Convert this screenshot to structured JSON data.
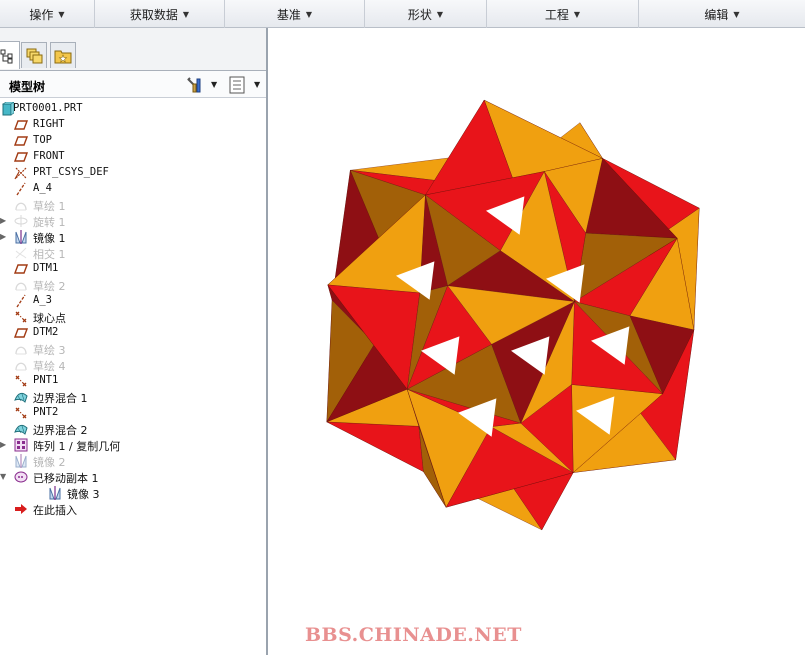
{
  "ribbon": {
    "groups": [
      {
        "label": "操作"
      },
      {
        "label": "获取数据"
      },
      {
        "label": "基准"
      },
      {
        "label": "形状"
      },
      {
        "label": "工程"
      },
      {
        "label": "编辑"
      }
    ]
  },
  "panel": {
    "tabs": [
      {
        "icon": "model-tree-tab-icon"
      },
      {
        "icon": "layers-tab-icon"
      },
      {
        "icon": "favorites-folder-tab-icon"
      }
    ],
    "tree_title": "模型树",
    "settings_icon": "tree-settings-icon",
    "show_icon": "tree-show-icon"
  },
  "tree": {
    "items": [
      {
        "label": "PRT0001.PRT",
        "icon": "part-icon",
        "dim": false,
        "expander": ""
      },
      {
        "label": "RIGHT",
        "icon": "datum-plane-icon",
        "dim": false,
        "expander": ""
      },
      {
        "label": "TOP",
        "icon": "datum-plane-icon",
        "dim": false,
        "expander": ""
      },
      {
        "label": "FRONT",
        "icon": "datum-plane-icon",
        "dim": false,
        "expander": ""
      },
      {
        "label": "PRT_CSYS_DEF",
        "icon": "coordinate-system-icon",
        "dim": false,
        "expander": ""
      },
      {
        "label": "A_4",
        "icon": "datum-axis-icon",
        "dim": false,
        "expander": ""
      },
      {
        "label": "草绘 1",
        "icon": "sketch-icon",
        "dim": true,
        "expander": ""
      },
      {
        "label": "旋转 1",
        "icon": "revolve-icon",
        "dim": true,
        "expander": "▶"
      },
      {
        "label": "镜像 1",
        "icon": "mirror-icon",
        "dim": false,
        "expander": "▶"
      },
      {
        "label": "相交 1",
        "icon": "intersect-icon",
        "dim": true,
        "expander": ""
      },
      {
        "label": "DTM1",
        "icon": "datum-plane-icon",
        "dim": false,
        "expander": ""
      },
      {
        "label": "草绘 2",
        "icon": "sketch-icon",
        "dim": true,
        "expander": ""
      },
      {
        "label": "A_3",
        "icon": "datum-axis-icon",
        "dim": false,
        "expander": ""
      },
      {
        "label": "球心点",
        "icon": "datum-point-icon",
        "dim": false,
        "expander": ""
      },
      {
        "label": "DTM2",
        "icon": "datum-plane-icon",
        "dim": false,
        "expander": ""
      },
      {
        "label": "草绘 3",
        "icon": "sketch-icon",
        "dim": true,
        "expander": ""
      },
      {
        "label": "草绘 4",
        "icon": "sketch-icon",
        "dim": true,
        "expander": ""
      },
      {
        "label": "PNT1",
        "icon": "datum-point-icon",
        "dim": false,
        "expander": ""
      },
      {
        "label": "边界混合 1",
        "icon": "boundary-blend-icon",
        "dim": false,
        "expander": ""
      },
      {
        "label": "PNT2",
        "icon": "datum-point-icon",
        "dim": false,
        "expander": ""
      },
      {
        "label": "边界混合 2",
        "icon": "boundary-blend-icon",
        "dim": false,
        "expander": ""
      },
      {
        "label": "阵列 1 / 复制几何",
        "icon": "pattern-icon",
        "dim": false,
        "expander": "▶"
      },
      {
        "label": "镜像 2",
        "icon": "mirror-icon",
        "dim": true,
        "expander": ""
      },
      {
        "label": "已移动副本 1",
        "icon": "moved-copy-icon",
        "dim": false,
        "expander": "▼"
      },
      {
        "label": "镜像 3",
        "icon": "mirror-icon",
        "dim": false,
        "expander": "",
        "child": true
      },
      {
        "label": "在此插入",
        "icon": "insert-here-arrow-icon",
        "dim": false,
        "expander": ""
      }
    ]
  },
  "viewport": {
    "model_name": "polyhedron-star-ball",
    "watermark": "BBS.CHINADE.NET",
    "colors": {
      "red": "#e8141a",
      "orange": "#f0a010",
      "dark_red": "#8e0f14",
      "brown": "#a26008"
    }
  }
}
